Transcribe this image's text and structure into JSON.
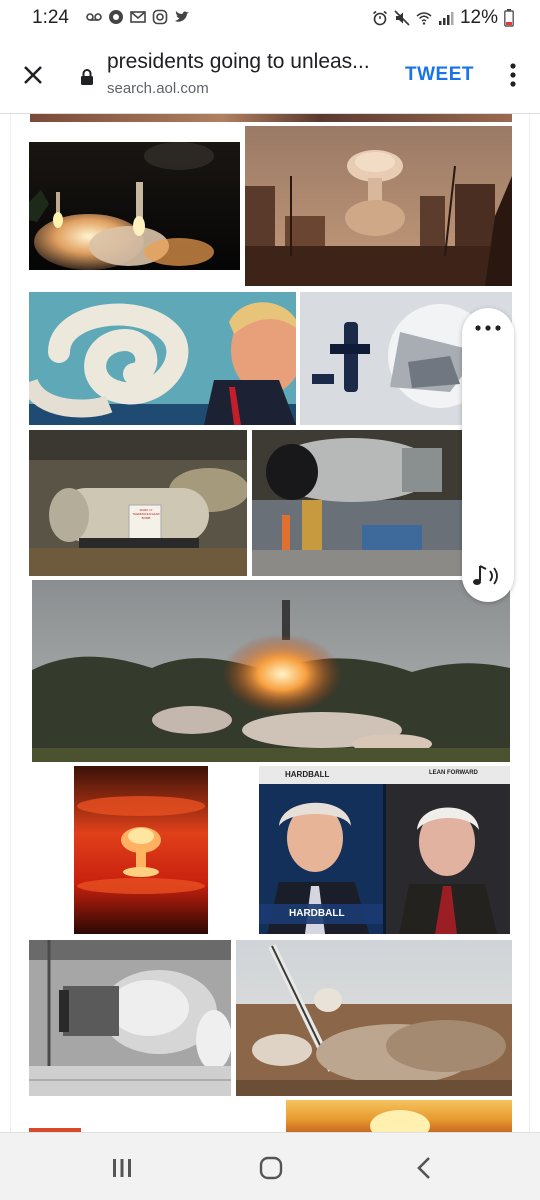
{
  "status_bar": {
    "time": "1:24",
    "battery": "12%",
    "left_icons": [
      "voicemail-icon",
      "chrome-icon",
      "gmail-icon",
      "instagram-icon",
      "twitter-icon"
    ],
    "right_icons": [
      "alarm-icon",
      "mute-icon",
      "wifi-icon",
      "signal-icon",
      "battery-low-icon"
    ]
  },
  "toolbar": {
    "title": "presidents going to unleas...",
    "domain": "search.aol.com",
    "tweet_label": "TWEET",
    "accent": "#1a73e8"
  },
  "image_results": [
    {
      "description": "rocket launch at night"
    },
    {
      "description": "mushroom cloud over ruined city"
    },
    {
      "description": "trump with missile smoke spiral"
    },
    {
      "description": "bomb casing in storage"
    },
    {
      "description": "nuclear bomb casing in museum"
    },
    {
      "description": "large bomb hoisted in factory"
    },
    {
      "description": "missile launch from forest"
    },
    {
      "description": "nuclear explosion fireball"
    },
    {
      "description": "hardball tv news split screen"
    },
    {
      "description": "fat man bomb black and white"
    },
    {
      "description": "missile launch in desert"
    },
    {
      "description": "fire explosion"
    }
  ],
  "tv_overlay": {
    "left_banner": "HARDBALL",
    "right_banner": "LEAN FORWARD",
    "lower_title": "HARDBALL"
  },
  "sign_text": "MARK 17\nTHERMONUCLEAR\nBOMB"
}
